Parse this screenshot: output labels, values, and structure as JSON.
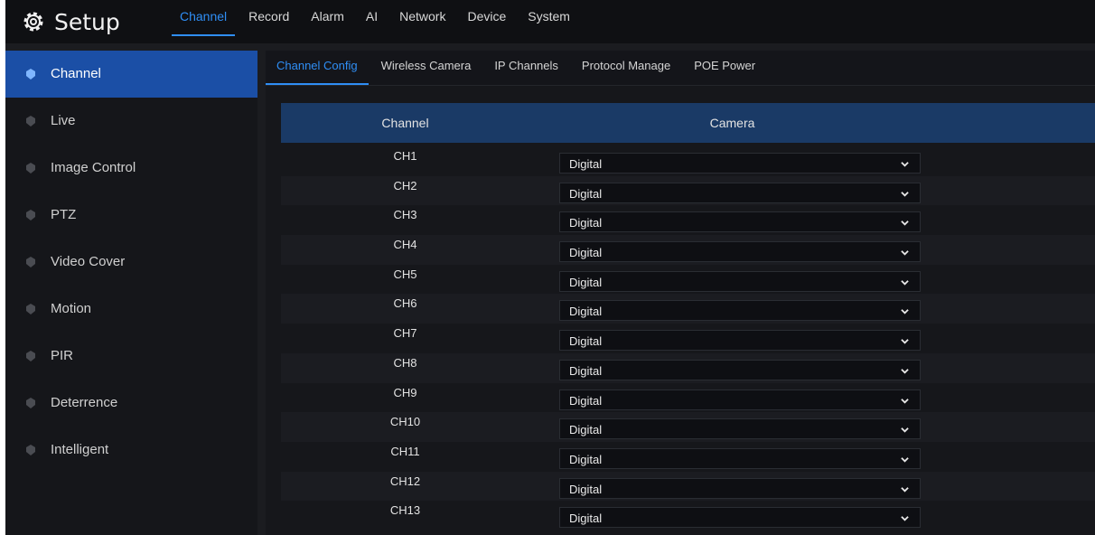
{
  "app": {
    "title": "Setup"
  },
  "main_nav": [
    {
      "label": "Channel",
      "active": true
    },
    {
      "label": "Record"
    },
    {
      "label": "Alarm"
    },
    {
      "label": "AI"
    },
    {
      "label": "Network"
    },
    {
      "label": "Device"
    },
    {
      "label": "System"
    }
  ],
  "sidebar": {
    "items": [
      {
        "label": "Channel",
        "active": true
      },
      {
        "label": "Live"
      },
      {
        "label": "Image Control"
      },
      {
        "label": "PTZ"
      },
      {
        "label": "Video Cover"
      },
      {
        "label": "Motion"
      },
      {
        "label": "PIR"
      },
      {
        "label": "Deterrence"
      },
      {
        "label": "Intelligent"
      }
    ]
  },
  "sub_tabs": [
    {
      "label": "Channel Config",
      "active": true
    },
    {
      "label": "Wireless Camera"
    },
    {
      "label": "IP Channels"
    },
    {
      "label": "Protocol Manage"
    },
    {
      "label": "POE Power"
    }
  ],
  "table": {
    "headers": {
      "channel": "Channel",
      "camera": "Camera"
    },
    "rows": [
      {
        "channel": "CH1",
        "camera": "Digital"
      },
      {
        "channel": "CH2",
        "camera": "Digital"
      },
      {
        "channel": "CH3",
        "camera": "Digital"
      },
      {
        "channel": "CH4",
        "camera": "Digital"
      },
      {
        "channel": "CH5",
        "camera": "Digital"
      },
      {
        "channel": "CH6",
        "camera": "Digital"
      },
      {
        "channel": "CH7",
        "camera": "Digital"
      },
      {
        "channel": "CH8",
        "camera": "Digital"
      },
      {
        "channel": "CH9",
        "camera": "Digital"
      },
      {
        "channel": "CH10",
        "camera": "Digital"
      },
      {
        "channel": "CH11",
        "camera": "Digital"
      },
      {
        "channel": "CH12",
        "camera": "Digital"
      },
      {
        "channel": "CH13",
        "camera": "Digital"
      }
    ]
  },
  "icons": {
    "logo": "gear-icon",
    "sidebar_bullet": "shield-bullet-icon",
    "dropdown": "chevron-down-icon"
  },
  "colors": {
    "accent": "#2f8ef5",
    "active_sidebar": "#1b4fa6",
    "table_header": "#1a3a66",
    "background": "#1b1c20"
  }
}
